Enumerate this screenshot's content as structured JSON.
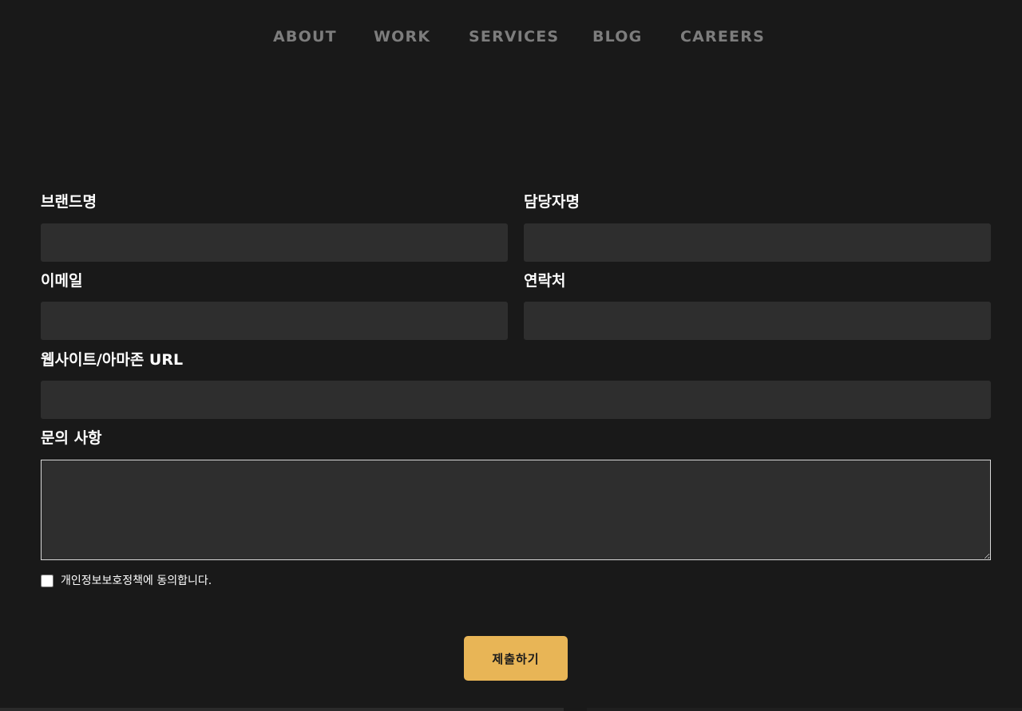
{
  "nav": {
    "items": [
      {
        "label": "ABOUT"
      },
      {
        "label": "WORK"
      },
      {
        "label": "SERVICES"
      },
      {
        "label": "BLOG"
      },
      {
        "label": "CAREERS"
      }
    ]
  },
  "form": {
    "brand": {
      "label": "브랜드명",
      "value": ""
    },
    "contact_person": {
      "label": "담당자명",
      "value": ""
    },
    "email": {
      "label": "이메일",
      "value": ""
    },
    "phone": {
      "label": "연락처",
      "value": ""
    },
    "website": {
      "label": "웹사이트/아마존 URL",
      "value": ""
    },
    "inquiry": {
      "label": "문의 사항",
      "value": ""
    },
    "consent": {
      "label": "개인정보보호정책에 동의합니다.",
      "checked": false
    },
    "submit_label": "제출하기"
  },
  "colors": {
    "background": "#191919",
    "input_background": "#2e2e2e",
    "nav_text": "#7d7d7d",
    "accent": "#e8b556"
  }
}
